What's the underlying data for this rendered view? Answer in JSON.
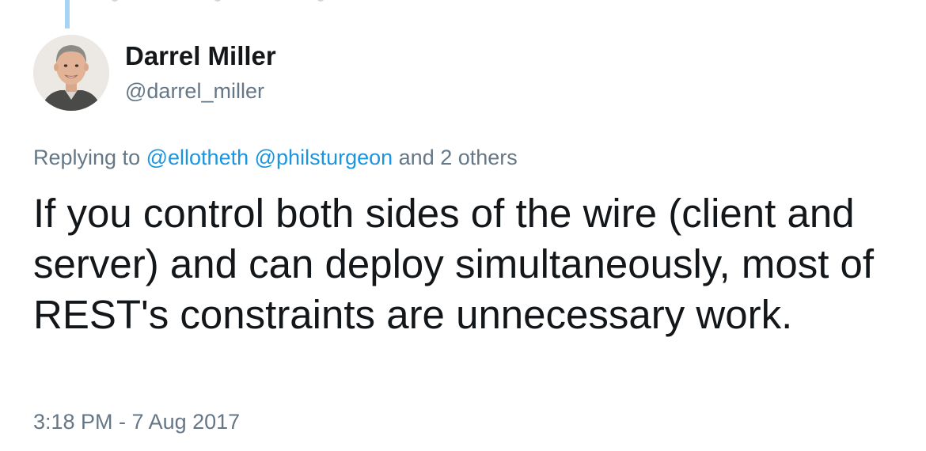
{
  "tweet": {
    "author": {
      "display_name": "Darrel Miller",
      "handle": "@darrel_miller",
      "avatar_icon": "profile-photo"
    },
    "replying_to": {
      "prefix": "Replying to",
      "mentions": [
        "@ellotheth",
        "@philsturgeon"
      ],
      "suffix": "and 2 others"
    },
    "text": "If you control both sides of the wire (client and server) and can deploy simultaneously, most of REST's constraints are unnecessary work.",
    "timestamp": "3:18 PM - 7 Aug 2017"
  },
  "colors": {
    "text_primary": "#14171a",
    "text_secondary": "#657786",
    "link": "#1b95e0",
    "thread_line": "#a6d4f2"
  }
}
